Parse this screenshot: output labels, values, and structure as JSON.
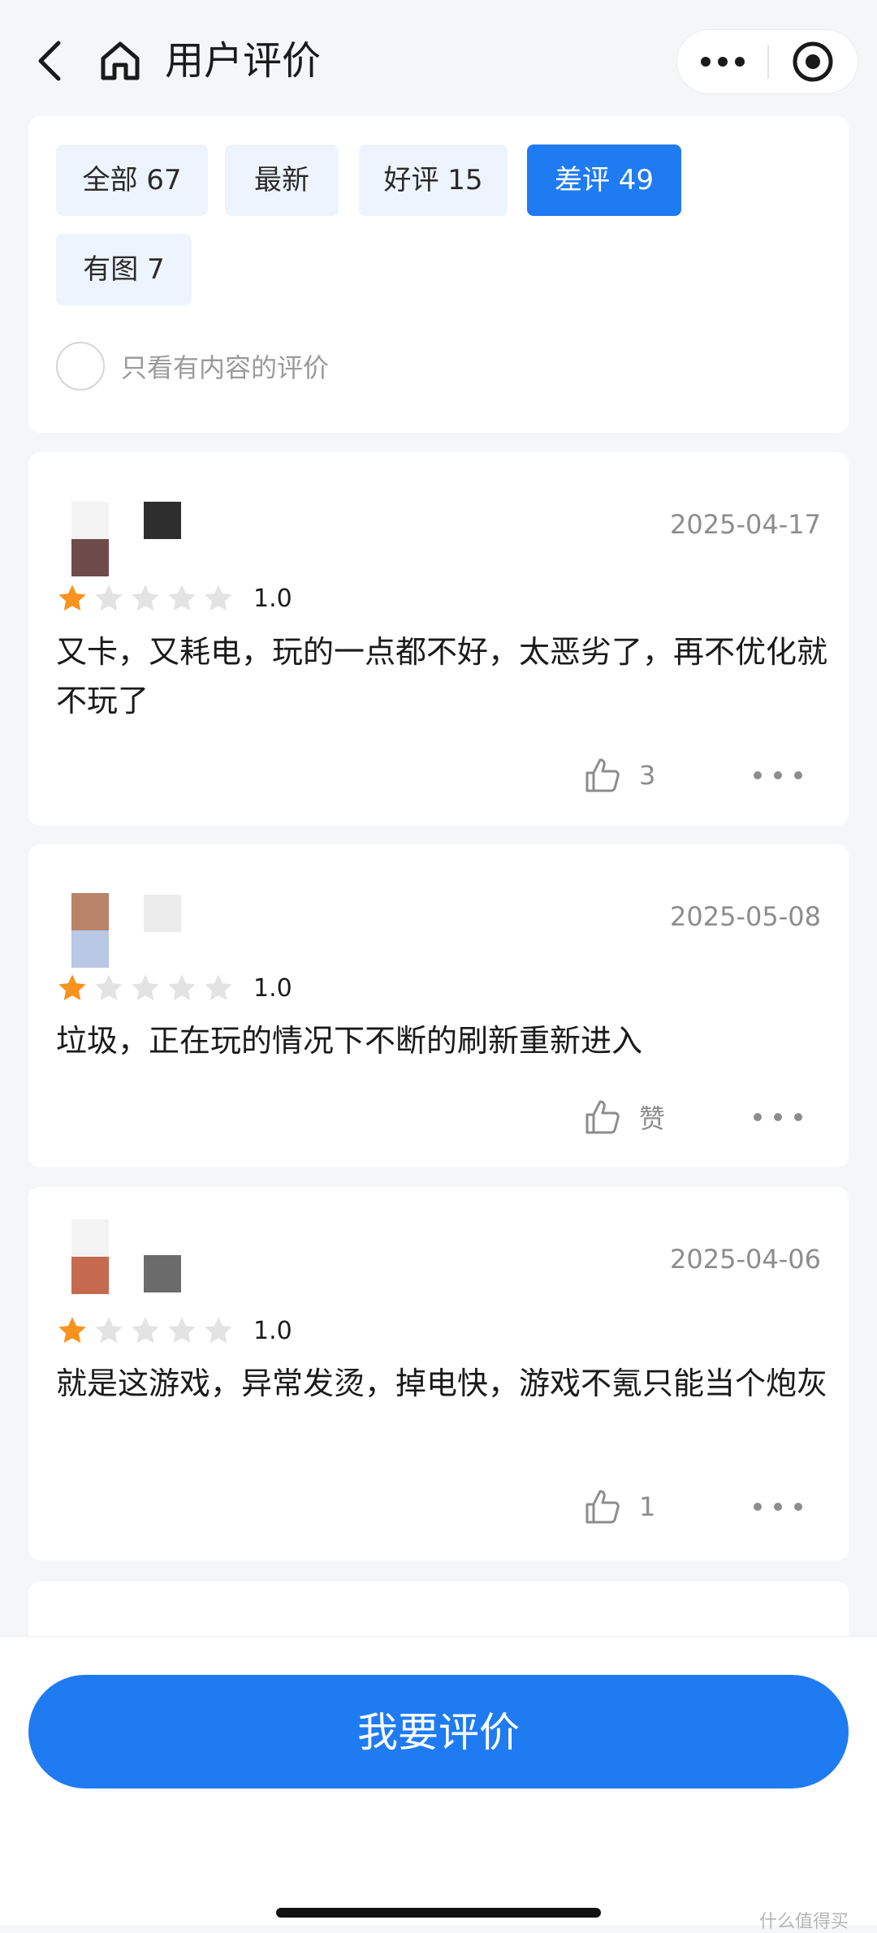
{
  "header": {
    "title": "用户评价",
    "back_icon": "back-arrow-icon",
    "home_icon": "home-icon",
    "more_icon": "more-dots-icon",
    "close_icon": "target-close-icon"
  },
  "filters": {
    "chips": [
      {
        "label": "全部 67",
        "active": false
      },
      {
        "label": "最新",
        "active": false
      },
      {
        "label": "好评 15",
        "active": false
      },
      {
        "label": "差评 49",
        "active": true
      },
      {
        "label": "有图 7",
        "active": false
      }
    ],
    "only_content_label": "只看有内容的评价",
    "only_content_checked": false
  },
  "reviews": [
    {
      "date": "2025-04-17",
      "rating": 1,
      "rating_label": "1.0",
      "text": "又卡，又耗电，玩的一点都不好，太恶劣了，再不优化就不玩了",
      "like_label": "3",
      "avatar_colors": [
        "#f3f3f3",
        "#6e4b4b"
      ],
      "name_color": "#2e2e2e"
    },
    {
      "date": "2025-05-08",
      "rating": 1,
      "rating_label": "1.0",
      "text": "垃圾，正在玩的情况下不断的刷新重新进入",
      "like_label": "赞",
      "avatar_colors": [
        "#b98468",
        "#b9c8e4"
      ],
      "name_color": "#ececec"
    },
    {
      "date": "2025-04-06",
      "rating": 1,
      "rating_label": "1.0",
      "text": "就是这游戏，异常发烫，掉电快，游戏不氪只能当个炮灰",
      "like_label": "1",
      "avatar_colors": [
        "#f3f3f3",
        "#c56a4e"
      ],
      "name_color": "#6b6b6b"
    }
  ],
  "bottom": {
    "button_label": "我要评价",
    "watermark": "什么值得买"
  },
  "colors": {
    "accent": "#1f7bf2",
    "star_active": "#f7931e",
    "star_inactive": "#e3e3e3"
  }
}
